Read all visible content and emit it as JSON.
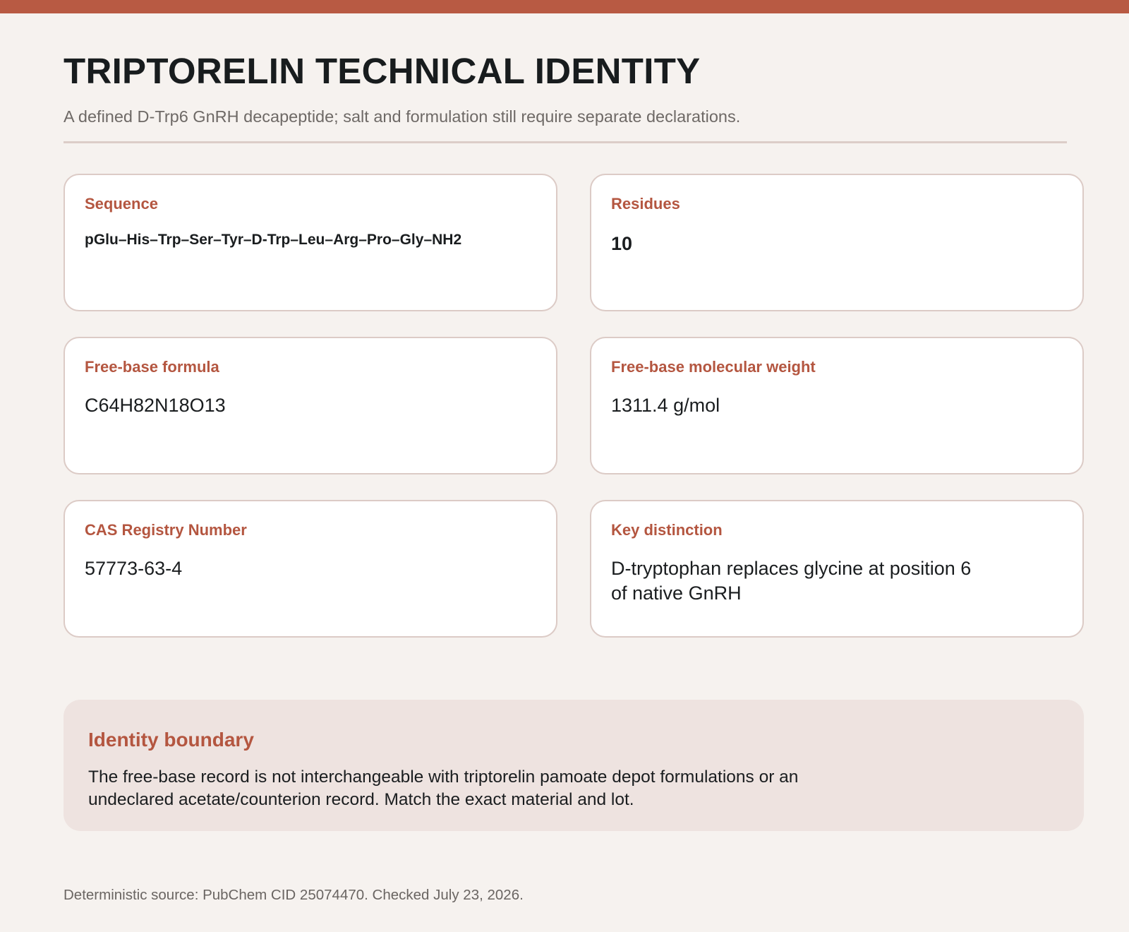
{
  "header": {
    "title": "TRIPTORELIN TECHNICAL IDENTITY",
    "subtitle": "A defined D-Trp6 GnRH decapeptide; salt and formulation still require separate declarations."
  },
  "cards": [
    {
      "label": "Sequence",
      "value": "pGlu–His–Trp–Ser–Tyr–D-Trp–Leu–Arg–Pro–Gly–NH2"
    },
    {
      "label": "Residues",
      "value": "10"
    },
    {
      "label": "Free-base formula",
      "value": "C64H82N18O13"
    },
    {
      "label": "Free-base molecular weight",
      "value": "1311.4 g/mol"
    },
    {
      "label": "CAS Registry Number",
      "value": "57773-63-4"
    },
    {
      "label": "Key distinction",
      "value": "D-tryptophan replaces glycine at position 6 of native GnRH"
    }
  ],
  "boundary": {
    "title": "Identity boundary",
    "text": "The free-base record is not interchangeable with triptorelin pamoate depot formulations or an undeclared acetate/counterion record. Match the exact material and lot."
  },
  "footer": {
    "source": "Deterministic source: PubChem CID 25074470. Checked July 23, 2026."
  },
  "colors": {
    "accent": "#b85a43",
    "background": "#f6f2ef",
    "card_border": "#dccbc6",
    "boundary_bg": "#eee3e0"
  }
}
